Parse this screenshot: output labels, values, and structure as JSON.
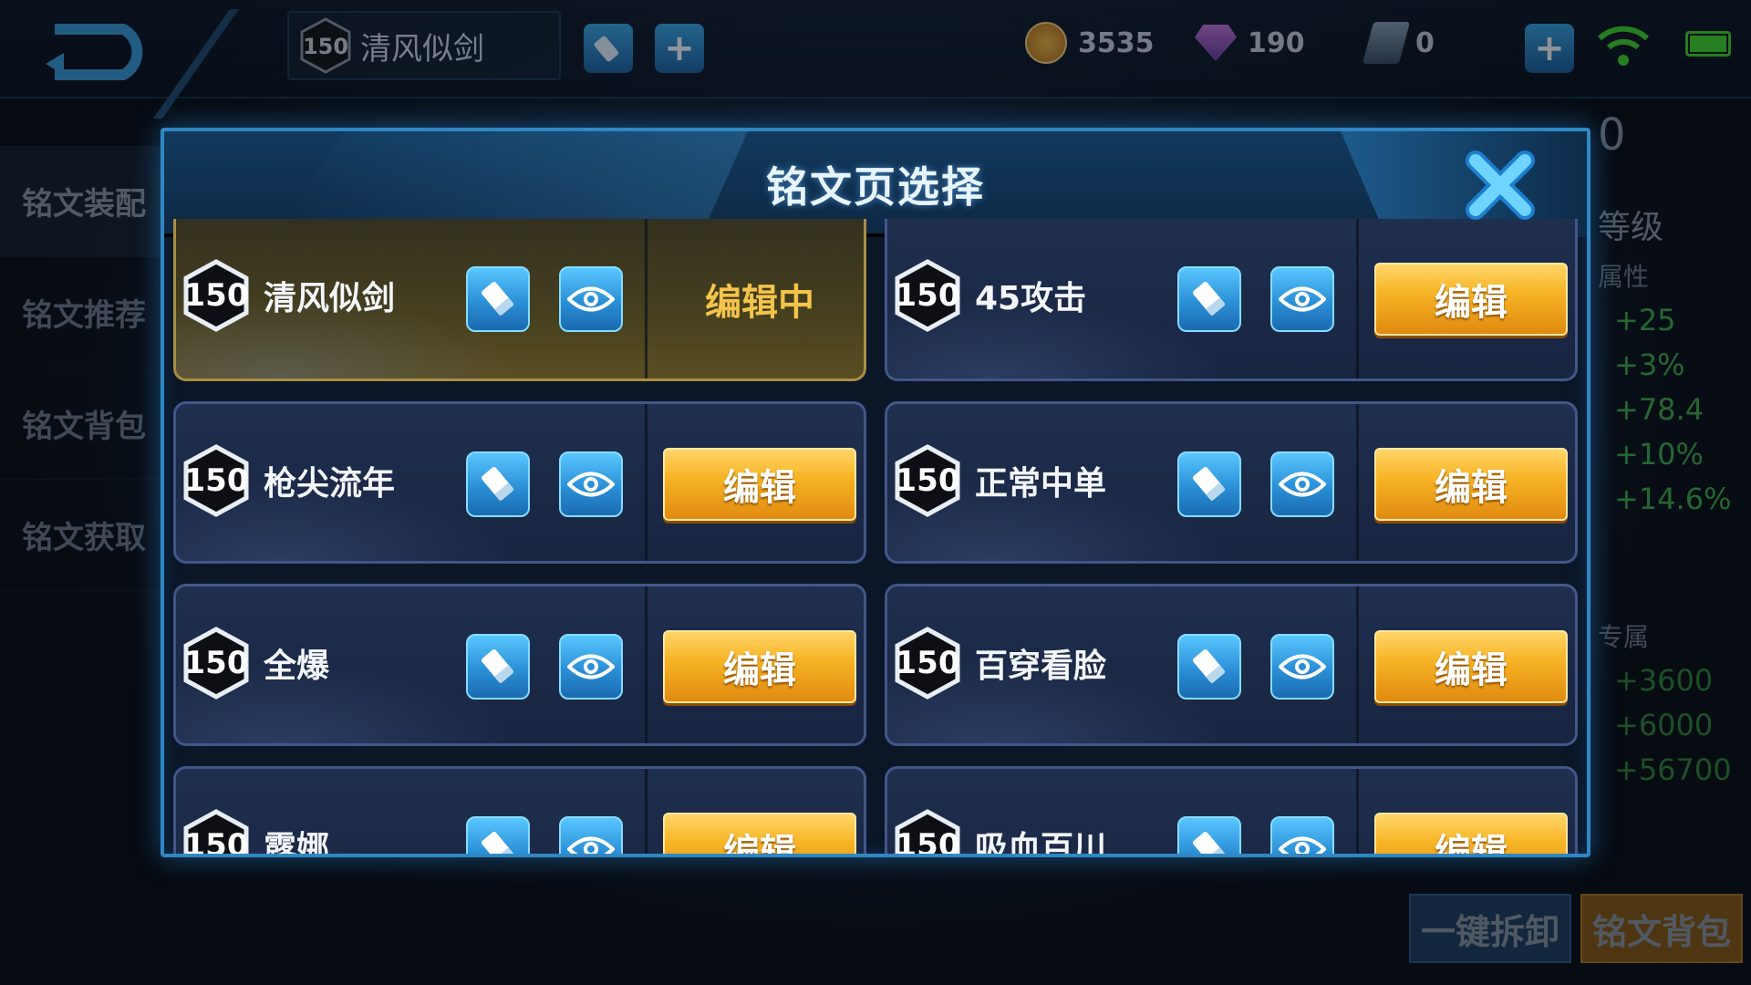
{
  "header": {
    "current_page_level": "150",
    "current_page_name": "清风似剑",
    "currencies": [
      {
        "name": "gold-coin",
        "value": "3535"
      },
      {
        "name": "diamond",
        "value": "190"
      },
      {
        "name": "ticket",
        "value": "0"
      }
    ]
  },
  "sidebar": {
    "items": [
      {
        "label": "铭文装配"
      },
      {
        "label": "铭文推荐"
      },
      {
        "label": "铭文背包"
      },
      {
        "label": "铭文获取"
      }
    ]
  },
  "right_panel": {
    "level_digit": "0",
    "level_label": "等级",
    "attr_label": "属性",
    "stats": [
      "+25",
      "+3%",
      "+78.4",
      "+10%",
      "+14.6%"
    ],
    "exclusive_label": "专属",
    "exclusive_stats": [
      "+3600",
      "+6000",
      "+56700"
    ]
  },
  "bottom": {
    "unload_all": "一键拆卸",
    "rune_bag": "铭文背包"
  },
  "modal": {
    "title": "铭文页选择",
    "edit_label": "编辑",
    "editing_label": "编辑中",
    "pages": [
      {
        "level": "150",
        "name": "清风似剑",
        "status": "editing"
      },
      {
        "level": "150",
        "name": "45攻击",
        "status": "edit"
      },
      {
        "level": "150",
        "name": "枪尖流年",
        "status": "edit"
      },
      {
        "level": "150",
        "name": "正常中单",
        "status": "edit"
      },
      {
        "level": "150",
        "name": "全爆",
        "status": "edit"
      },
      {
        "level": "150",
        "name": "百穿看脸",
        "status": "edit"
      },
      {
        "level": "150",
        "name": "露娜",
        "status": "edit"
      },
      {
        "level": "150",
        "name": "吸血百川",
        "status": "edit"
      }
    ]
  },
  "colors": {
    "accent_blue": "#2f87c4",
    "edit_gold": "#f7b526",
    "stat_green": "#3bb24a"
  }
}
